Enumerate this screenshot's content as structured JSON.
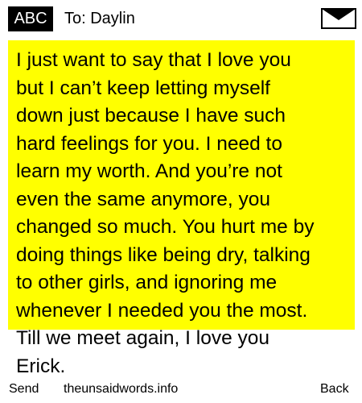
{
  "header": {
    "mode_label": "ABC",
    "recipient": "To: Daylin",
    "message_icon": "envelope-icon"
  },
  "message": {
    "highlight_color": "#ffff00",
    "text": "I just want to say that I love you\nbut I can’t keep letting myself\ndown just because I have such\nhard feelings for you. I need to\nlearn my worth. And you’re not\neven the same anymore, you\nchanged so much. You hurt me by\ndoing things like being dry, talking\nto other girls, and ignoring me\nwhenever I needed you the most.\nTill we meet again, I love you\nErick."
  },
  "softkeys": {
    "left": "Send",
    "center": "theunsaidwords.info",
    "right": "Back"
  }
}
